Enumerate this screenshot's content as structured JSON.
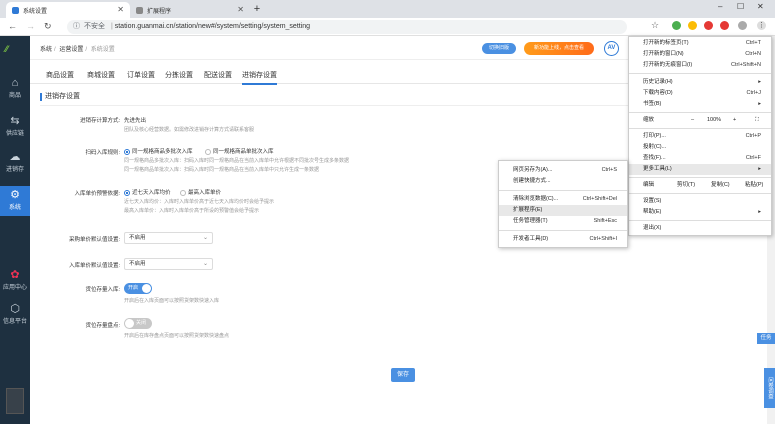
{
  "browser": {
    "tabs": [
      {
        "title": "系统设置",
        "active": true
      },
      {
        "title": "扩展程序",
        "active": false
      }
    ],
    "new_tab_label": "+",
    "url": "station.guanmai.cn/station/new#/system/setting/system_setting",
    "security_text": "不安全",
    "win_min": "–",
    "win_max": "☐",
    "win_close": "✕"
  },
  "sidebar": {
    "logo": "⁄⁄",
    "items": [
      {
        "label": "商品",
        "icon": "⌂"
      },
      {
        "label": "供应链",
        "icon": "⇆"
      },
      {
        "label": "进销存",
        "icon": "☁"
      },
      {
        "label": "系统",
        "icon": "⚙"
      },
      {
        "label": "应用中心",
        "icon": "✿"
      },
      {
        "label": "信息平台",
        "icon": "⬡"
      }
    ]
  },
  "topbar": {
    "breadcrumb": [
      "系统",
      "运营设置",
      "系统设置"
    ],
    "switch_btn": "切换旧版",
    "promo_btn": "新功能上线，点击查看",
    "avatar": "AV"
  },
  "subtabs": [
    "商品设置",
    "商城设置",
    "订单设置",
    "分拣设置",
    "配送设置",
    "进销存设置"
  ],
  "section_title": "进销存设置",
  "form": {
    "inventory_method": {
      "label": "进销存计算方式:",
      "value": "先进先出",
      "hint": "团队及核心经营数据。如需修改进销存计算方式请联系客服"
    },
    "scan_rule": {
      "label": "扫码入库规则:",
      "opt1": "同一规格商品多批次入库",
      "opt2": "同一规格商品单批次入库",
      "hint1": "同一规格商品多批次入库：扫码入库时同一规格商品在当前入库单中允许根据不同批次号生成多条数据",
      "hint2": "同一规格商品单批次入库：扫码入库时同一规格商品在当前入库单中只允许生成一条数据"
    },
    "price_warning": {
      "label": "入库单价预警依据:",
      "opt1": "近七天入库均价",
      "opt2": "最高入库单价",
      "hint1": "近七天入库均价：入库时入库单价高于近七天入库均价时会给予提示",
      "hint2": "最高入库单价：入库时入库单价高于所设的预警值会给予提示"
    },
    "purchase_default": {
      "label": "采购单价默认值设置:",
      "value": "不启用"
    },
    "stockin_default": {
      "label": "入库单价默认值设置:",
      "value": "不启用"
    },
    "shelf_in": {
      "label": "货位存量入库:",
      "toggle": "开启",
      "hint": "开启后在入库页面可以按照货架数快速入库"
    },
    "shelf_show": {
      "label": "货位存量盘点:",
      "toggle": "关闭",
      "hint": "开启后在库存盘点页面可以按照货架数快速盘点"
    },
    "save": "保存"
  },
  "ctx_main": [
    {
      "l": "打开新的标签页(T)",
      "r": "Ctrl+T"
    },
    {
      "l": "打开新的窗口(N)",
      "r": "Ctrl+N"
    },
    {
      "l": "打开新的无痕窗口(I)",
      "r": "Ctrl+Shift+N"
    },
    {
      "l": "历史记录(H)",
      "r": "▸"
    },
    {
      "l": "下载内容(D)",
      "r": "Ctrl+J"
    },
    {
      "l": "书签(B)",
      "r": "▸"
    },
    {
      "l": "缩放",
      "r": ""
    },
    {
      "l": "打印(P)...",
      "r": "Ctrl+P"
    },
    {
      "l": "投射(C)...",
      "r": ""
    },
    {
      "l": "查找(F)...",
      "r": "Ctrl+F"
    },
    {
      "l": "更多工具(L)",
      "r": "▸"
    },
    {
      "l": "设置(S)",
      "r": ""
    },
    {
      "l": "帮助(E)",
      "r": "▸"
    },
    {
      "l": "退出(X)",
      "r": ""
    }
  ],
  "zoom": {
    "minus": "–",
    "value": "100%",
    "plus": "+",
    "full": "⛶"
  },
  "edit_row": {
    "label": "编辑",
    "cut": "剪切(T)",
    "copy": "复制(C)",
    "paste": "粘贴(P)"
  },
  "ctx_sub": [
    {
      "l": "网页另存为(A)...",
      "r": "Ctrl+S"
    },
    {
      "l": "创建快捷方式...",
      "r": ""
    },
    {
      "l": "清除浏览数据(C)...",
      "r": "Ctrl+Shift+Del"
    },
    {
      "l": "扩展程序(E)",
      "r": ""
    },
    {
      "l": "任务管理器(T)",
      "r": "Shift+Esc"
    },
    {
      "l": "开发者工具(D)",
      "r": "Ctrl+Shift+I"
    }
  ],
  "right_tags": {
    "task": "任务",
    "survey": "问卷调查"
  }
}
